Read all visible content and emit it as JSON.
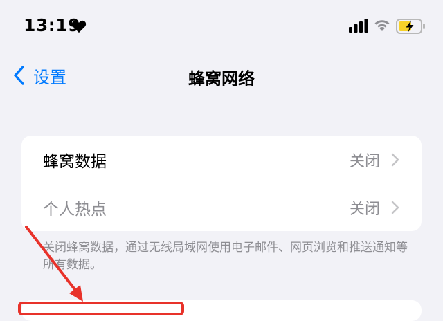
{
  "status": {
    "time": "13:19"
  },
  "nav": {
    "back_label": "设置",
    "title": "蜂窝网络"
  },
  "rows": [
    {
      "label": "蜂窝数据",
      "value": "关闭"
    },
    {
      "label": "个人热点",
      "value": "关闭"
    }
  ],
  "footer_note": "关闭蜂窝数据，通过无线局域网使用电子邮件、网页浏览和推送通知等所有数据。",
  "colors": {
    "accent": "#007aff",
    "secondary_text": "#8e8e93",
    "annotation": "#e8322a",
    "battery_charge": "#f7d22a"
  }
}
